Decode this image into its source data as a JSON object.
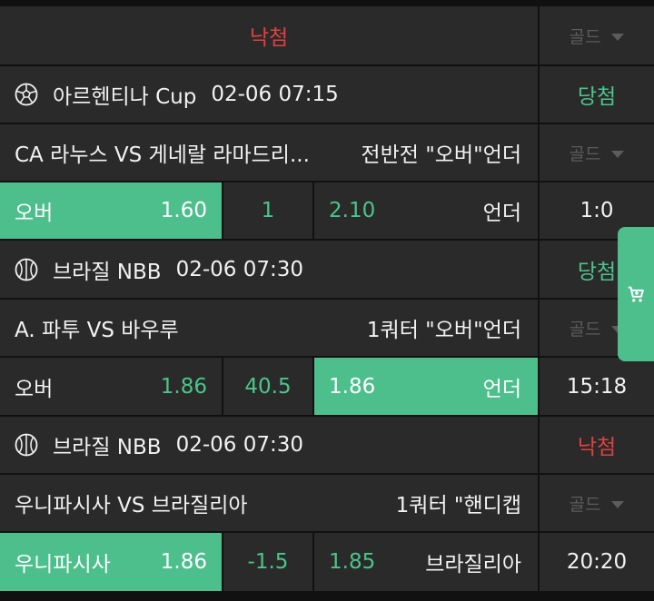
{
  "colors": {
    "accent": "#4cbf8c",
    "lose": "#e04040",
    "win": "#4ac58d",
    "cell": "#2a2a2a",
    "bg": "#111111"
  },
  "top": {
    "status": "낙첨",
    "gold": "골드"
  },
  "bets": [
    {
      "league": {
        "icon": "soccer-ball-icon",
        "name": "아르헨티나 Cup",
        "datetime": "02-06 07:15",
        "result": "당첨",
        "result_type": "win"
      },
      "match": {
        "teams": "CA 라누스 VS 게네랄 라마드리...",
        "market": "전반전 \"오버\"언더",
        "gold": "골드"
      },
      "odds": {
        "left_label": "오버",
        "left_value": "1.60",
        "center": "1",
        "right_value": "2.10",
        "right_label": "언더",
        "score": "1:0",
        "selected": "left"
      }
    },
    {
      "league": {
        "icon": "basketball-icon",
        "name": "브라질 NBB",
        "datetime": "02-06 07:30",
        "result": "당첨",
        "result_type": "win"
      },
      "match": {
        "teams": "A. 파투 VS 바우루",
        "market": "1쿼터 \"오버\"언더",
        "gold": "골드"
      },
      "odds": {
        "left_label": "오버",
        "left_value": "1.86",
        "center": "40.5",
        "right_value": "1.86",
        "right_label": "언더",
        "score": "15:18",
        "selected": "right"
      }
    },
    {
      "league": {
        "icon": "basketball-icon",
        "name": "브라질 NBB",
        "datetime": "02-06 07:30",
        "result": "낙첨",
        "result_type": "lose"
      },
      "match": {
        "teams": "우니파시사 VS 브라질리아",
        "market": "1쿼터 \"핸디캡",
        "gold": "골드"
      },
      "odds": {
        "left_label": "우니파시사",
        "left_value": "1.86",
        "center": "-1.5",
        "right_value": "1.85",
        "right_label": "브라질리아",
        "score": "20:20",
        "selected": "left"
      }
    }
  ],
  "cart": {
    "icon": "cart-icon"
  }
}
